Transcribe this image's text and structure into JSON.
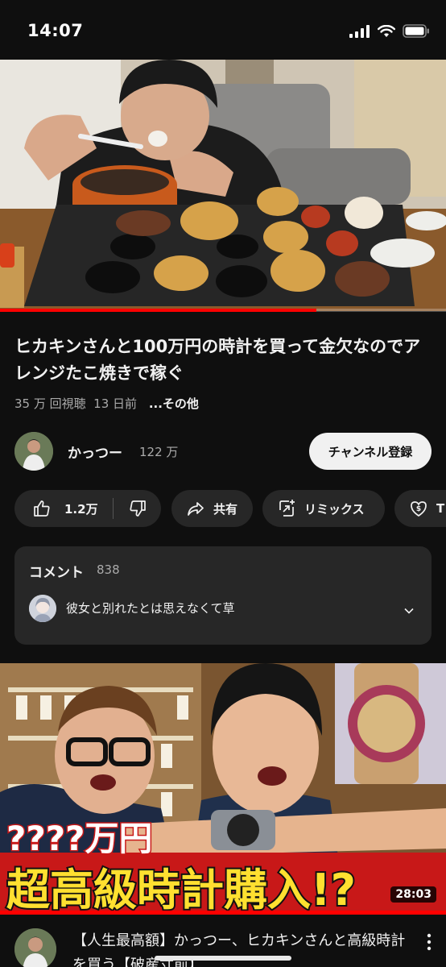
{
  "status_bar": {
    "time": "14:07"
  },
  "video": {
    "title": "ヒカキンさんと100万円の時計を買って金欠なのでアレンジたこ焼きで稼ぐ",
    "views": "35 万 回視聴",
    "age": "13 日前",
    "more_label": "...その他",
    "progress_fraction": 0.71
  },
  "channel": {
    "name": "かっつー",
    "subscribers": "122 万",
    "subscribe_label": "チャンネル登録"
  },
  "actions": {
    "likes": "1.2万",
    "share": "共有",
    "remix": "リミックス",
    "thanks": "T"
  },
  "comments": {
    "title": "コメント",
    "count": "838",
    "top_comment": "彼女と別れたとは思えなくて草"
  },
  "next_video": {
    "thumb_text_top": "????万円",
    "thumb_text_bottom": "超高級時計購入!?",
    "duration": "28:03",
    "title": "【人生最高額】かっつー、ヒカキンさんと高級時計を買う【破産寸前】"
  },
  "colors": {
    "background": "#0f0f0f",
    "chip": "#272727",
    "accent": "#ff0000"
  }
}
